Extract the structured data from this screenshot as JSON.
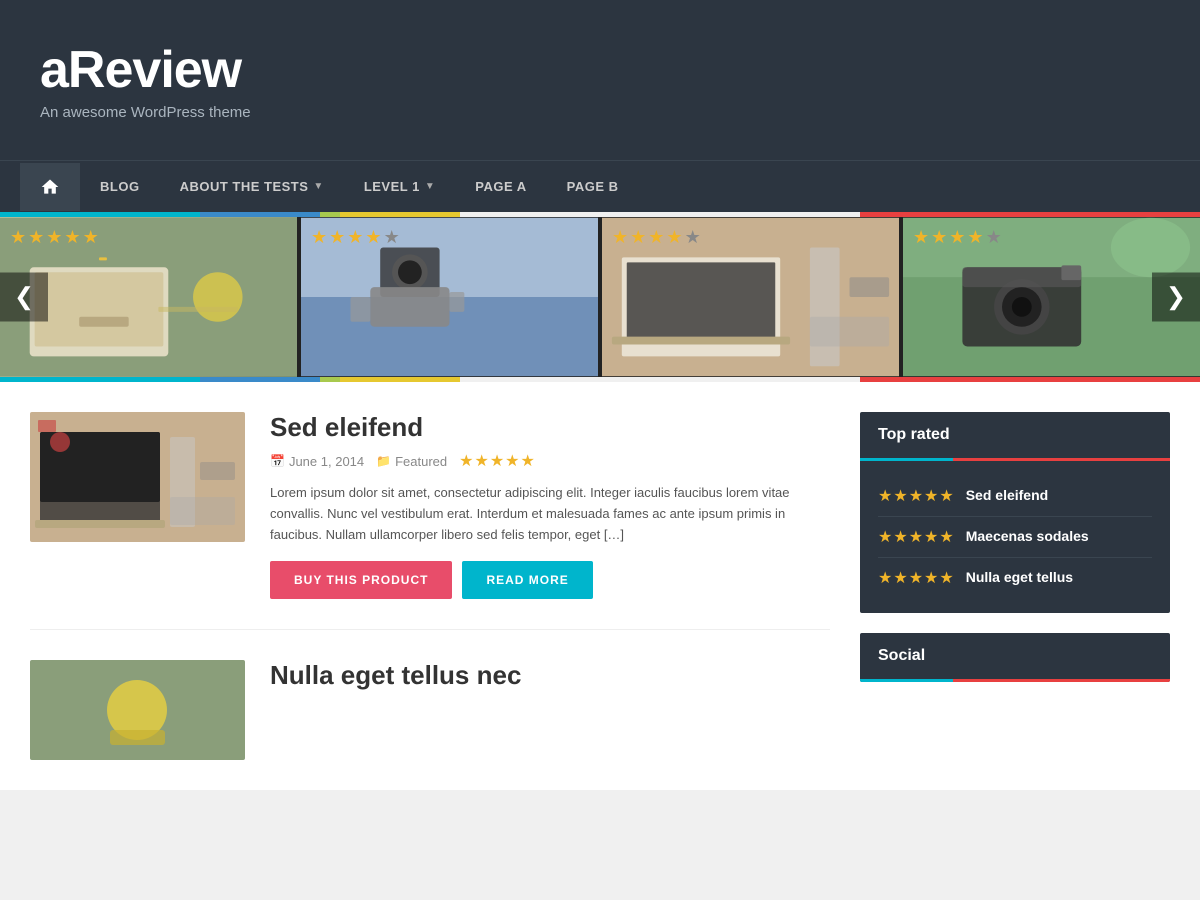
{
  "site": {
    "title": "aReview",
    "tagline": "An awesome WordPress theme"
  },
  "nav": {
    "items": [
      {
        "id": "home",
        "label": "Home",
        "icon": "home-icon",
        "hasDropdown": false
      },
      {
        "id": "blog",
        "label": "BLOG",
        "hasDropdown": false
      },
      {
        "id": "about",
        "label": "ABOUT THE TESTS",
        "hasDropdown": true
      },
      {
        "id": "level1",
        "label": "LEVEL 1",
        "hasDropdown": true
      },
      {
        "id": "pageA",
        "label": "PAGE A",
        "hasDropdown": false
      },
      {
        "id": "pageB",
        "label": "PAGE B",
        "hasDropdown": false
      }
    ]
  },
  "carousel": {
    "prev_label": "❮",
    "next_label": "❯",
    "items": [
      {
        "id": 1,
        "stars": 4.5,
        "stars_full": 4,
        "stars_half": 1,
        "stars_empty": 0,
        "color": "img-desk"
      },
      {
        "id": 2,
        "stars": 3.5,
        "stars_full": 3,
        "stars_half": 1,
        "stars_empty": 1,
        "color": "img-cam1"
      },
      {
        "id": 3,
        "stars": 3.5,
        "stars_full": 3,
        "stars_half": 1,
        "stars_empty": 1,
        "color": "img-laptop"
      },
      {
        "id": 4,
        "stars": 4.0,
        "stars_full": 4,
        "stars_half": 0,
        "stars_empty": 1,
        "color": "img-cam2"
      }
    ]
  },
  "articles": [
    {
      "id": 1,
      "title": "Sed eleifend",
      "date": "June 1, 2014",
      "category": "Featured",
      "stars_full": 4,
      "stars_half": 1,
      "excerpt": "Lorem ipsum dolor sit amet, consectetur adipiscing elit. Integer iaculis faucibus lorem vitae convallis. Nunc vel vestibulum erat. Interdum et malesuada fames ac ante ipsum primis in faucibus. Nullam ullamcorper libero sed felis tempor, eget […]",
      "btn_buy": "BUY THIS PRODUCT",
      "btn_read": "READ MORE"
    },
    {
      "id": 2,
      "title": "Nulla eget tellus nec",
      "date": "",
      "category": "",
      "stars_full": 0,
      "stars_half": 0
    }
  ],
  "sidebar": {
    "top_rated": {
      "title": "Top rated",
      "items": [
        {
          "id": 1,
          "title": "Sed eleifend",
          "stars_full": 4,
          "stars_half": 1,
          "stars_empty": 0
        },
        {
          "id": 2,
          "title": "Maecenas sodales",
          "stars_full": 4,
          "stars_half": 1,
          "stars_empty": 0
        },
        {
          "id": 3,
          "title": "Nulla eget tellus",
          "stars_full": 4,
          "stars_half": 1,
          "stars_empty": 0
        }
      ]
    },
    "social": {
      "title": "Social"
    }
  }
}
